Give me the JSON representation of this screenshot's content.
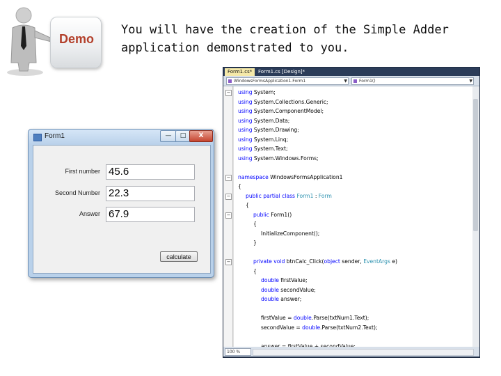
{
  "slide": {
    "badge_text": "Demo",
    "lines": [
      "You will have the creation of the Simple Adder",
      "application demonstrated to you."
    ]
  },
  "form_window": {
    "title": "Form1",
    "controls": {
      "minimize": "—",
      "maximize": "□",
      "close": "X"
    },
    "fields": [
      {
        "label": "First number",
        "value": "45.6"
      },
      {
        "label": "Second Number",
        "value": "22.3"
      },
      {
        "label": "Answer",
        "value": "67.9"
      }
    ],
    "button_label": "calculate"
  },
  "ide": {
    "tabs": [
      "Form1.cs*",
      "Form1.cs [Design]*"
    ],
    "class_combo": "WindowsFormsApplication1.Form1",
    "member_combo": "Form1()",
    "zoom": "100 %",
    "code_lines": [
      {
        "indent": 0,
        "tokens": [
          {
            "t": "using",
            "c": "kw"
          },
          {
            "t": " System;"
          }
        ]
      },
      {
        "indent": 0,
        "tokens": [
          {
            "t": "using",
            "c": "kw"
          },
          {
            "t": " System.Collections.Generic;"
          }
        ]
      },
      {
        "indent": 0,
        "tokens": [
          {
            "t": "using",
            "c": "kw"
          },
          {
            "t": " System.ComponentModel;"
          }
        ]
      },
      {
        "indent": 0,
        "tokens": [
          {
            "t": "using",
            "c": "kw"
          },
          {
            "t": " System.Data;"
          }
        ]
      },
      {
        "indent": 0,
        "tokens": [
          {
            "t": "using",
            "c": "kw"
          },
          {
            "t": " System.Drawing;"
          }
        ]
      },
      {
        "indent": 0,
        "tokens": [
          {
            "t": "using",
            "c": "kw"
          },
          {
            "t": " System.Linq;"
          }
        ]
      },
      {
        "indent": 0,
        "tokens": [
          {
            "t": "using",
            "c": "kw"
          },
          {
            "t": " System.Text;"
          }
        ]
      },
      {
        "indent": 0,
        "tokens": [
          {
            "t": "using",
            "c": "kw"
          },
          {
            "t": " System.Windows.Forms;"
          }
        ]
      },
      {
        "indent": 0,
        "tokens": []
      },
      {
        "indent": 0,
        "tokens": [
          {
            "t": "namespace",
            "c": "kw"
          },
          {
            "t": " WindowsFormsApplication1"
          }
        ]
      },
      {
        "indent": 0,
        "tokens": [
          {
            "t": "{"
          }
        ]
      },
      {
        "indent": 1,
        "tokens": [
          {
            "t": "public",
            "c": "kw"
          },
          {
            "t": " "
          },
          {
            "t": "partial",
            "c": "kw"
          },
          {
            "t": " "
          },
          {
            "t": "class",
            "c": "kw"
          },
          {
            "t": " "
          },
          {
            "t": "Form1",
            "c": "ty"
          },
          {
            "t": " : "
          },
          {
            "t": "Form",
            "c": "ty"
          }
        ]
      },
      {
        "indent": 1,
        "tokens": [
          {
            "t": "{"
          }
        ]
      },
      {
        "indent": 2,
        "tokens": [
          {
            "t": "public",
            "c": "kw"
          },
          {
            "t": " Form1()"
          }
        ]
      },
      {
        "indent": 2,
        "tokens": [
          {
            "t": "{"
          }
        ]
      },
      {
        "indent": 3,
        "tokens": [
          {
            "t": "InitializeComponent();"
          }
        ]
      },
      {
        "indent": 2,
        "tokens": [
          {
            "t": "}"
          }
        ]
      },
      {
        "indent": 0,
        "tokens": []
      },
      {
        "indent": 2,
        "tokens": [
          {
            "t": "private",
            "c": "kw"
          },
          {
            "t": " "
          },
          {
            "t": "void",
            "c": "kw"
          },
          {
            "t": " btnCalc_Click("
          },
          {
            "t": "object",
            "c": "kw"
          },
          {
            "t": " sender, "
          },
          {
            "t": "EventArgs",
            "c": "ty"
          },
          {
            "t": " e)"
          }
        ]
      },
      {
        "indent": 2,
        "tokens": [
          {
            "t": "{"
          }
        ]
      },
      {
        "indent": 3,
        "tokens": [
          {
            "t": "double",
            "c": "kw"
          },
          {
            "t": " firstValue;"
          }
        ]
      },
      {
        "indent": 3,
        "tokens": [
          {
            "t": "double",
            "c": "kw"
          },
          {
            "t": " secondValue;"
          }
        ]
      },
      {
        "indent": 3,
        "tokens": [
          {
            "t": "double",
            "c": "kw"
          },
          {
            "t": " answer;"
          }
        ]
      },
      {
        "indent": 0,
        "tokens": []
      },
      {
        "indent": 3,
        "tokens": [
          {
            "t": "firstValue = "
          },
          {
            "t": "double",
            "c": "kw"
          },
          {
            "t": ".Parse(txtNum1.Text);"
          }
        ]
      },
      {
        "indent": 3,
        "tokens": [
          {
            "t": "secondValue = "
          },
          {
            "t": "double",
            "c": "kw"
          },
          {
            "t": ".Parse(txtNum2.Text);"
          }
        ]
      },
      {
        "indent": 0,
        "tokens": []
      },
      {
        "indent": 3,
        "tokens": [
          {
            "t": "answer = firstValue + secondValue;"
          }
        ]
      }
    ]
  }
}
